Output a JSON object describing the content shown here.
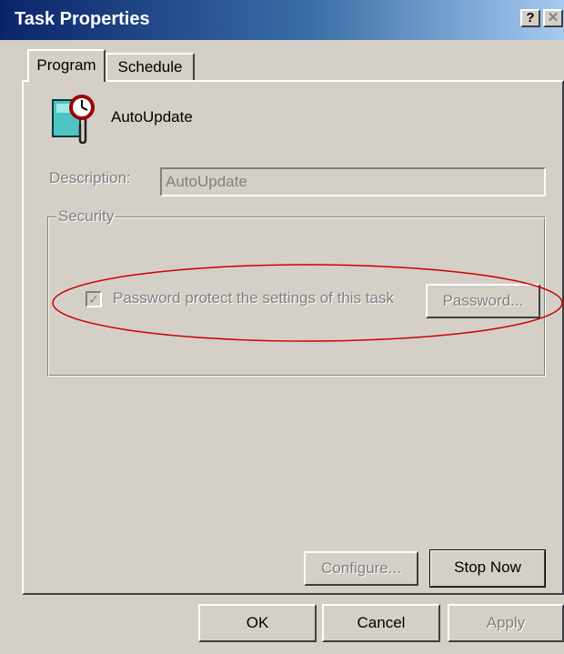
{
  "window": {
    "title": "Task Properties",
    "help_label": "?",
    "close_label": "✕"
  },
  "tabs": [
    {
      "label": "Program",
      "active": true
    },
    {
      "label": "Schedule",
      "active": false
    }
  ],
  "task": {
    "icon": "scheduled-task-clock-icon",
    "name": "AutoUpdate"
  },
  "description": {
    "label": "Description:",
    "value": "AutoUpdate",
    "enabled": false
  },
  "security": {
    "group_label": "Security",
    "password_protect": {
      "label": "Password protect the settings of this task",
      "checked": true,
      "enabled": false,
      "mark": "✓"
    },
    "password_button": "Password..."
  },
  "buttons": {
    "configure": "Configure...",
    "stop_now": "Stop Now",
    "ok": "OK",
    "cancel": "Cancel",
    "apply": "Apply"
  },
  "colors": {
    "annotation_ellipse": "#cc0000",
    "titlebar_start": "#0a246a",
    "titlebar_end": "#a6caf0",
    "dialog_face": "#d4d0c8"
  }
}
